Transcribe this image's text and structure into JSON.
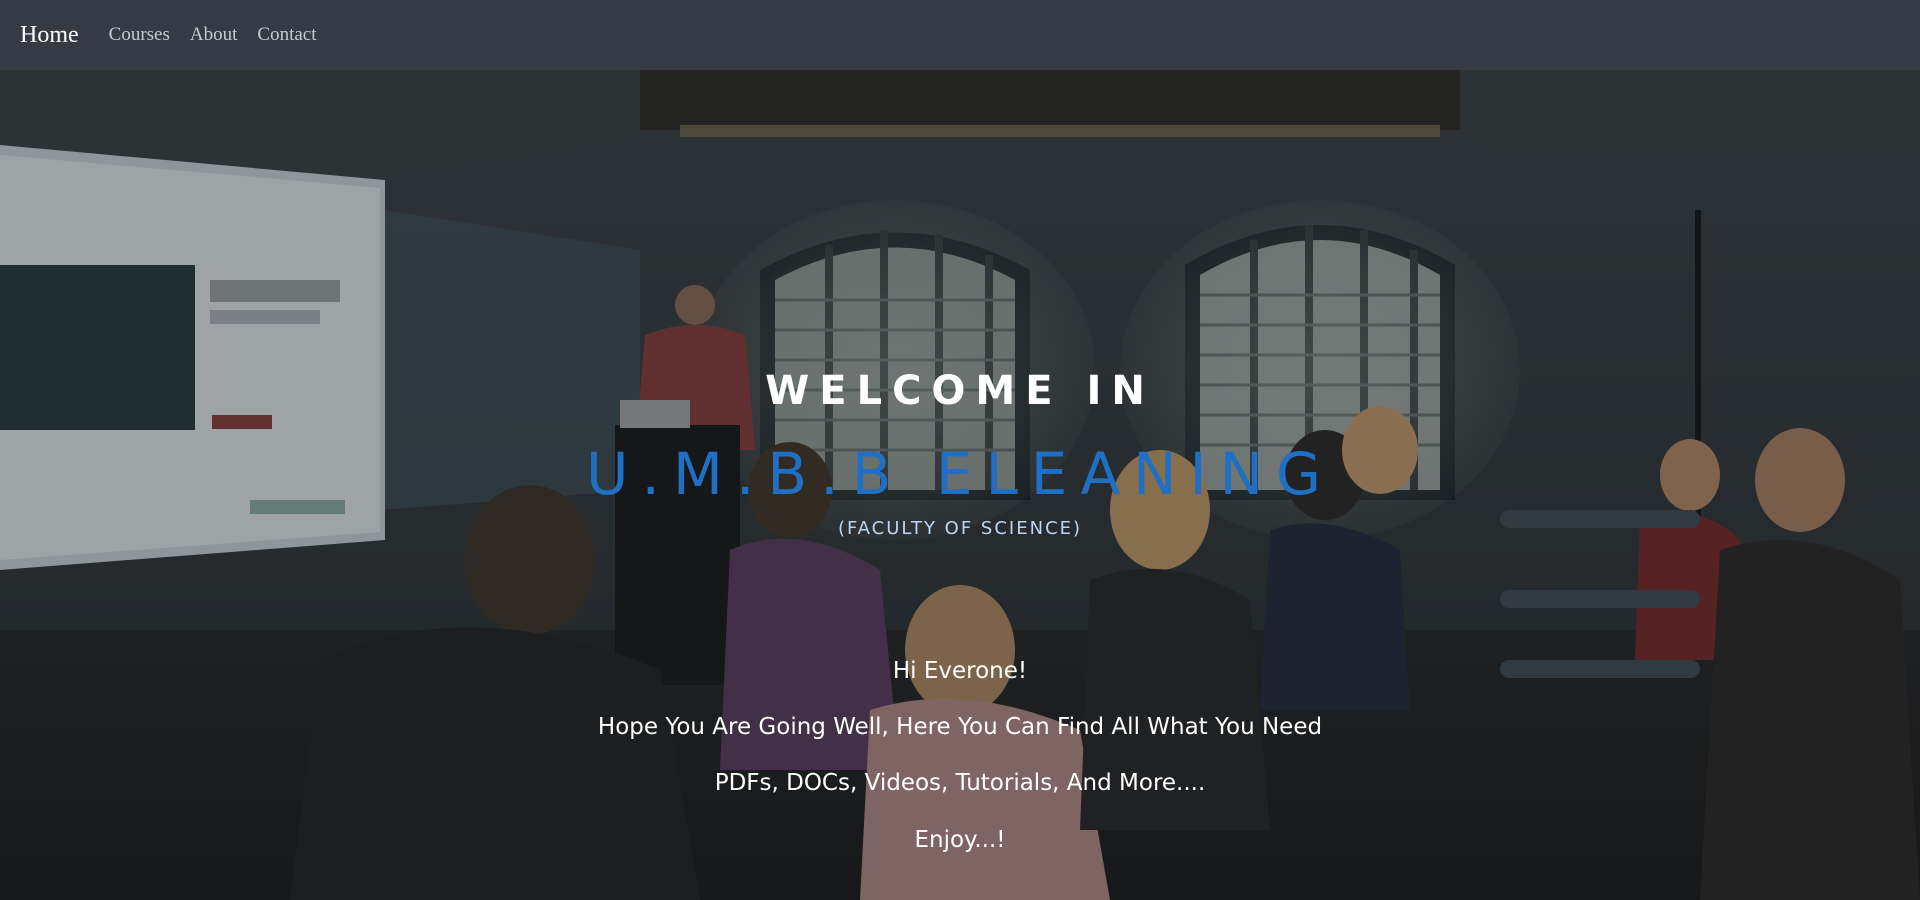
{
  "navbar": {
    "brand": "Home",
    "links": [
      "Courses",
      "About",
      "Contact"
    ]
  },
  "hero": {
    "welcome": "WELCOME IN",
    "site_name": "U.M.B.B ELEANING",
    "faculty": "(FACULTY OF SCIENCE)",
    "messages": [
      "Hi Everone!",
      "Hope You Are Going Well, Here You Can Find All What You Need",
      "PDFs, DOCs, Videos, Tutorials, And More....",
      "Enjoy...!"
    ],
    "background_image": "classroom lecture photo",
    "accent_color": "#1f6fc4"
  }
}
